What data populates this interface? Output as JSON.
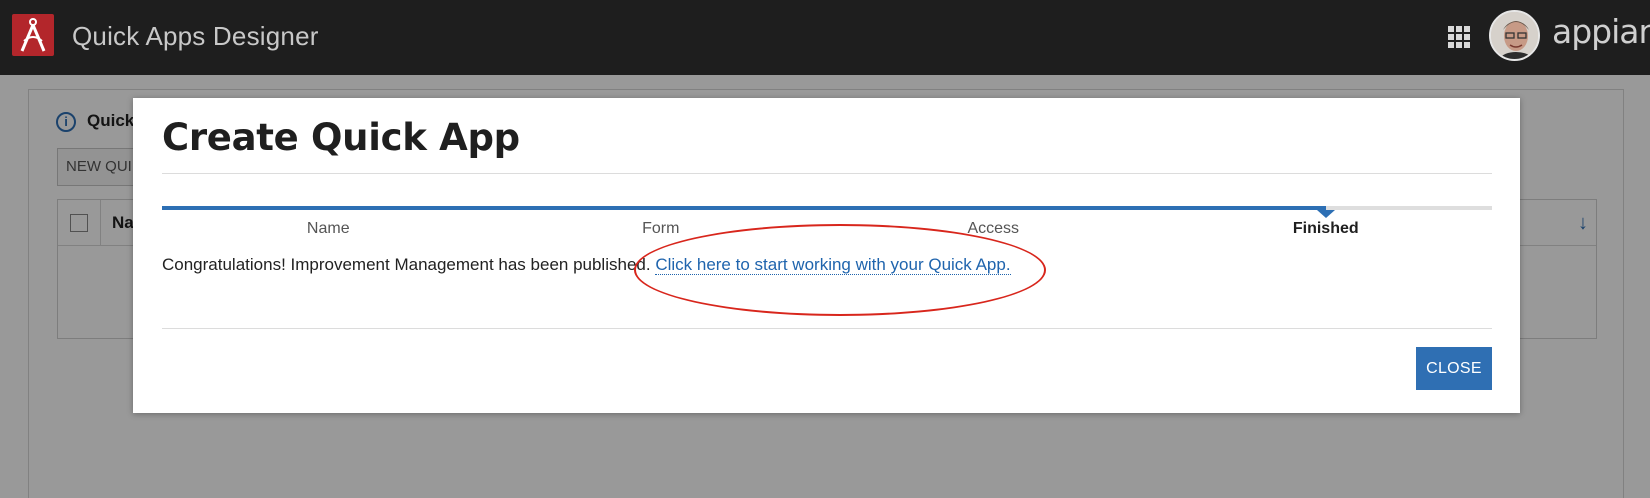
{
  "header": {
    "app_title": "Quick Apps Designer",
    "brand_name": "appian",
    "logo_icon": "appian-compass-logo-icon",
    "apps_icon": "grid-apps-icon",
    "avatar_icon": "user-avatar",
    "logo_color": "#b3262b"
  },
  "background_page": {
    "heading": "Quick",
    "new_button_label": "NEW QUI",
    "table": {
      "name_column_header": "Na",
      "sort_icon": "arrow-down-icon"
    }
  },
  "modal": {
    "title": "Create Quick App",
    "progress": {
      "fraction": 0.875,
      "steps": [
        {
          "label": "Name",
          "active": false
        },
        {
          "label": "Form",
          "active": false
        },
        {
          "label": "Access",
          "active": false
        },
        {
          "label": "Finished",
          "active": true
        }
      ]
    },
    "message_text": "Congratulations! Improvement Management has been published.",
    "link_text": "Click here to start working with your Quick App.",
    "close_label": "CLOSE",
    "accent_color": "#2d6fb4",
    "annotation_color": "#d8261c"
  }
}
